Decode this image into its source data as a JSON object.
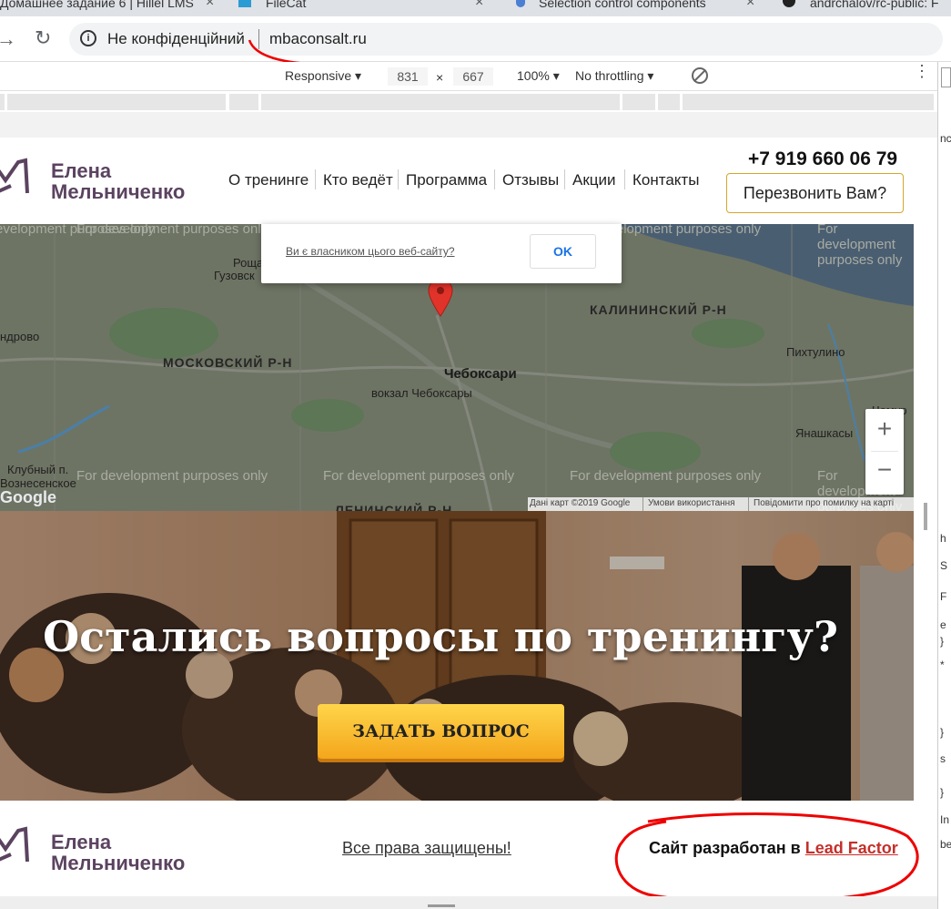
{
  "browser": {
    "tabs": [
      {
        "title": "Домашнее задание 6 | Hillel LMS"
      },
      {
        "title": "FileCat"
      },
      {
        "title": "Selection control components"
      },
      {
        "title": "andrchalov/rc-public: F"
      }
    ],
    "security_text": "Не конфіденційний",
    "url": "mbaconsalt.ru"
  },
  "devtools": {
    "device": "Responsive",
    "width": "831",
    "times": "×",
    "height": "667",
    "zoom": "100%",
    "throttling": "No throttling",
    "side_fragments": [
      "nc",
      "h",
      "S",
      "F",
      "e",
      "}",
      "*",
      "}",
      "s",
      "}",
      "In",
      "be"
    ]
  },
  "site": {
    "logo_line1": "Елена",
    "logo_line2": "Мельниченко",
    "nav": [
      "О тренинге",
      "Кто ведёт",
      "Программа",
      "Отзывы",
      "Акции",
      "Контакты"
    ],
    "phone": "+7 919 660 06 79",
    "callback_label": "Перезвонить Вам?",
    "accent_color": "#d4a62a"
  },
  "map": {
    "watermark": "For development purposes only",
    "dialog_link": "Ви є власником цього веб-сайту?",
    "dialog_ok": "OK",
    "labels": {
      "roshcha": "Роща",
      "guzovsky": "Гузовск",
      "androvo": "ндрово",
      "moskovsky": "МОСКОВСКИЙ Р-Н",
      "kalininsky": "КАЛИНИНСКИЙ Р-Н",
      "pikhtulino": "Пихтулино",
      "cheboksary": "Чебоксари",
      "station": "вокзал Чебоксары",
      "yanashkasy": "Янашкасы",
      "klubny": "Клубный п.",
      "vozsenskoe": "Вознесенское",
      "leninsky": "ЛЕНИНСКИЙ Р-Н",
      "chemur": "Чемур"
    },
    "zoom_in": "+",
    "zoom_out": "−",
    "google": "Google",
    "footer_data": "Дані карт ©2019 Google",
    "footer_terms": "Умови використання",
    "footer_report": "Повідомити про помилку на карті"
  },
  "hero": {
    "title": "Остались вопросы по тренингу?",
    "button": "ЗАДАТЬ ВОПРОС"
  },
  "footer": {
    "logo_line1": "Елена",
    "logo_line2": "Мельниченко",
    "rights": "Все права защищены!",
    "developed_by": "Сайт разработан в ",
    "studio": "Lead Factor"
  }
}
